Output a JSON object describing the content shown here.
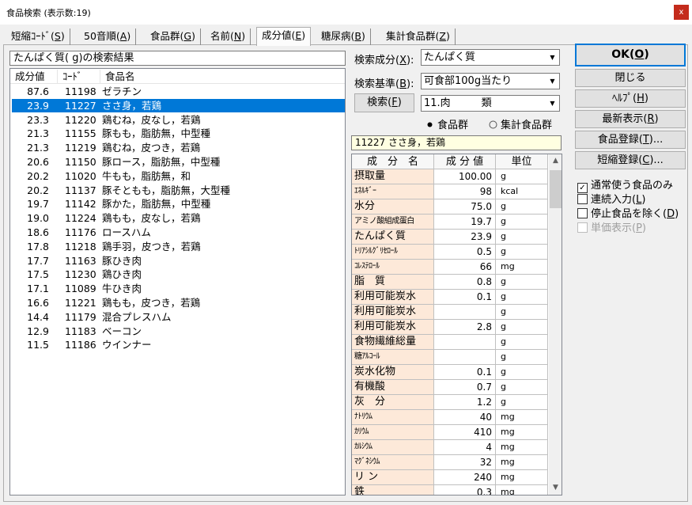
{
  "window": {
    "title": "食品検索 (表示数:19)",
    "close_glyph": "x"
  },
  "tabs": [
    {
      "label": "短縮ｺｰﾄﾞ(",
      "key": "S",
      "end": ")"
    },
    {
      "label": "50音順(",
      "key": "A",
      "end": ")"
    },
    {
      "label": "食品群(",
      "key": "G",
      "end": ")"
    },
    {
      "label": "名前(",
      "key": "N",
      "end": ")"
    },
    {
      "label": "成分値(",
      "key": "E",
      "end": ")"
    },
    {
      "label": "糖尿病(",
      "key": "B",
      "end": ")"
    },
    {
      "label": "集計食品群(",
      "key": "Z",
      "end": ")"
    }
  ],
  "results": {
    "title": "たんぱく質( g)の検索結果",
    "headers": {
      "value": "成分値",
      "code": "ｺｰﾄﾞ",
      "name": "食品名"
    },
    "rows": [
      {
        "value": "87.6",
        "code": "11198",
        "name": "ゼラチン"
      },
      {
        "value": "23.9",
        "code": "11227",
        "name": "ささ身，若鶏"
      },
      {
        "value": "23.3",
        "code": "11220",
        "name": "鶏むね，皮なし，若鶏"
      },
      {
        "value": "21.3",
        "code": "11155",
        "name": "豚もも，脂肪無，中型種"
      },
      {
        "value": "21.3",
        "code": "11219",
        "name": "鶏むね，皮つき，若鶏"
      },
      {
        "value": "20.6",
        "code": "11150",
        "name": "豚ロース，脂肪無，中型種"
      },
      {
        "value": "20.2",
        "code": "11020",
        "name": "牛もも，脂肪無，和"
      },
      {
        "value": "20.2",
        "code": "11137",
        "name": "豚そともも，脂肪無，大型種"
      },
      {
        "value": "19.7",
        "code": "11142",
        "name": "豚かた，脂肪無，中型種"
      },
      {
        "value": "19.0",
        "code": "11224",
        "name": "鶏もも，皮なし，若鶏"
      },
      {
        "value": "18.6",
        "code": "11176",
        "name": "ロースハム"
      },
      {
        "value": "17.8",
        "code": "11218",
        "name": "鶏手羽，皮つき，若鶏"
      },
      {
        "value": "17.7",
        "code": "11163",
        "name": "豚ひき肉"
      },
      {
        "value": "17.5",
        "code": "11230",
        "name": "鶏ひき肉"
      },
      {
        "value": "17.1",
        "code": "11089",
        "name": "牛ひき肉"
      },
      {
        "value": "16.6",
        "code": "11221",
        "name": "鶏もも，皮つき，若鶏"
      },
      {
        "value": "14.4",
        "code": "11179",
        "name": "混合プレスハム"
      },
      {
        "value": "12.9",
        "code": "11183",
        "name": "ベーコン"
      },
      {
        "value": "11.5",
        "code": "11186",
        "name": "ウインナー"
      }
    ]
  },
  "search": {
    "component_label": "検索成分(",
    "component_key": "X",
    "component_end": "):",
    "component_value": "たんぱく質",
    "basis_label": "検索基準(",
    "basis_key": "B",
    "basis_end": "):",
    "basis_value": "可食部100g当たり",
    "search_button": "検索(",
    "search_key": "F",
    "search_end": ")",
    "group_value": "11.肉　　　類",
    "radio_food_group": "食品群",
    "radio_summary_group": "集計食品群",
    "selected_food": "11227 ささ身，若鶏"
  },
  "nutrients": {
    "headers": {
      "name": "成　分　名",
      "value": "成 分 値",
      "unit": "単位"
    },
    "rows": [
      {
        "name": "摂取量",
        "value": "100.00",
        "unit": "g"
      },
      {
        "name": "ｴﾈﾙｷﾞｰ",
        "value": "98",
        "unit": "kcal"
      },
      {
        "name": "水分",
        "value": "75.0",
        "unit": "g"
      },
      {
        "name": "アミノ酸組成蛋白",
        "value": "19.7",
        "unit": "g"
      },
      {
        "name": "たんぱく質",
        "value": "23.9",
        "unit": "g"
      },
      {
        "name": "ﾄﾘｱｼﾙｸﾞﾘｾﾛｰﾙ",
        "value": "0.5",
        "unit": "g"
      },
      {
        "name": "ｺﾚｽﾃﾛｰﾙ",
        "value": "66",
        "unit": "mg"
      },
      {
        "name": "脂　質",
        "value": "0.8",
        "unit": "g"
      },
      {
        "name": "利用可能炭水",
        "value": "0.1",
        "unit": "g"
      },
      {
        "name": "利用可能炭水",
        "value": "",
        "unit": "g"
      },
      {
        "name": "利用可能炭水",
        "value": "2.8",
        "unit": "g"
      },
      {
        "name": "食物繊維総量",
        "value": "",
        "unit": "g"
      },
      {
        "name": "糖ｱﾙｺｰﾙ",
        "value": "",
        "unit": "g"
      },
      {
        "name": "炭水化物",
        "value": "0.1",
        "unit": "g"
      },
      {
        "name": "有機酸",
        "value": "0.7",
        "unit": "g"
      },
      {
        "name": "灰　分",
        "value": "1.2",
        "unit": "g"
      },
      {
        "name": "ﾅﾄﾘｳﾑ",
        "value": "40",
        "unit": "mg"
      },
      {
        "name": "ｶﾘｳﾑ",
        "value": "410",
        "unit": "mg"
      },
      {
        "name": "ｶﾙｼｳﾑ",
        "value": "4",
        "unit": "mg"
      },
      {
        "name": "ﾏｸﾞﾈｼｳﾑ",
        "value": "32",
        "unit": "mg"
      },
      {
        "name": "リ ン",
        "value": "240",
        "unit": "mg"
      },
      {
        "name": "鉄",
        "value": "0.3",
        "unit": "mg"
      }
    ]
  },
  "buttons": {
    "ok": "OK(",
    "ok_key": "O",
    "ok_end": ")",
    "close": "閉じる",
    "help": "ﾍﾙﾌﾟ(",
    "help_key": "H",
    "help_end": ")",
    "refresh": "最新表示(",
    "refresh_key": "R",
    "refresh_end": ")",
    "register_food": "食品登録(",
    "register_food_key": "T",
    "register_food_end": ")...",
    "register_short": "短縮登録(",
    "register_short_key": "C",
    "register_short_end": ")..."
  },
  "options": {
    "common_only": "通常使う食品のみ",
    "continuous": "連続入力(",
    "continuous_key": "L",
    "continuous_end": ")",
    "exclude_stopped": "停止食品を除く(",
    "exclude_stopped_key": "D",
    "exclude_stopped_end": ")",
    "unit_price": "単価表示(",
    "unit_price_key": "P",
    "unit_price_end": ")"
  }
}
